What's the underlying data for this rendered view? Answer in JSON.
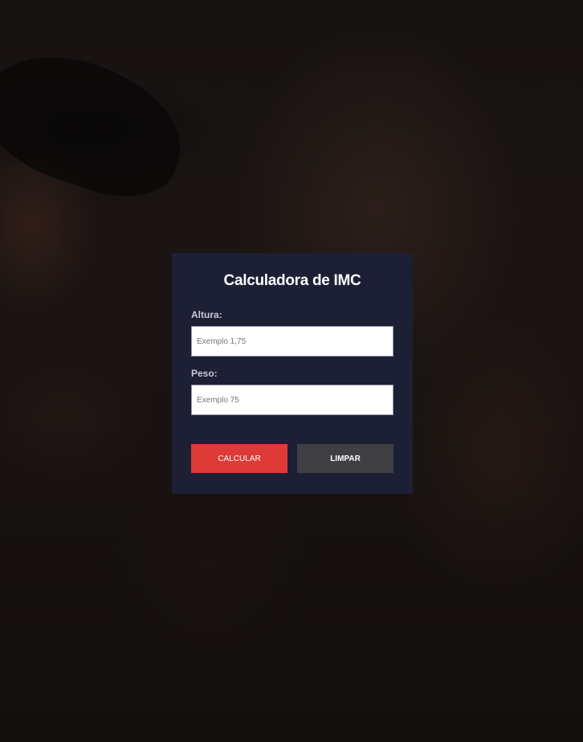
{
  "form": {
    "title": "Calculadora de IMC",
    "height_label": "Altura:",
    "height_placeholder": "Exemplo 1,75",
    "weight_label": "Peso:",
    "weight_placeholder": "Exemplo 75",
    "calculate_label": "CALCULAR",
    "clear_label": "LIMPAR"
  },
  "colors": {
    "card_background": "#1d1f35",
    "calculate_button": "#de3a37",
    "clear_button": "#3f3f44"
  }
}
